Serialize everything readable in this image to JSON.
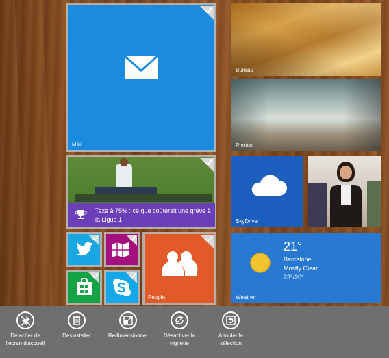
{
  "tiles": {
    "mail": {
      "label": "Mail",
      "color": "#1b8be0",
      "icon": "mail-icon"
    },
    "bureau": {
      "label": "Bureau"
    },
    "photos": {
      "label": "Photos"
    },
    "sports": {
      "headline": "Taxe à 75% : ce que coûterait une grève à la Ligue 1",
      "color": "#6a3fb8",
      "icon": "trophy-icon"
    },
    "skydrive": {
      "label": "SkyDrive",
      "color": "#1d5fbf",
      "icon": "cloud-icon"
    },
    "twitter": {
      "color": "#1aa5e3",
      "icon": "twitter-bird-icon"
    },
    "maps": {
      "color": "#a5117c",
      "icon": "map-icon"
    },
    "store": {
      "color": "#14a345",
      "icon": "store-bag-icon"
    },
    "skype": {
      "color": "#14a8e8",
      "icon": "skype-icon"
    },
    "people": {
      "label": "People",
      "color": "#e25a2a",
      "icon": "people-icon"
    },
    "weather": {
      "label": "Weather",
      "color": "#2879d2",
      "icon": "sun-icon",
      "temp": "21°",
      "city": "Barcelone",
      "condition": "Mostly Clear",
      "range": "23°/20°"
    }
  },
  "appbar": {
    "detach": {
      "line1": "Détacher de",
      "line2": "l'écran d'accueil",
      "icon": "unpin-icon"
    },
    "uninstall": {
      "line1": "Désinstaller",
      "icon": "trash-icon"
    },
    "resize": {
      "line1": "Redimensionner",
      "icon": "resize-icon"
    },
    "live": {
      "line1": "Désactiver la",
      "line2": "vignette",
      "icon": "live-tile-off-icon"
    },
    "cancel": {
      "line1": "Annuler la",
      "line2": "sélection",
      "icon": "cancel-selection-icon"
    }
  }
}
